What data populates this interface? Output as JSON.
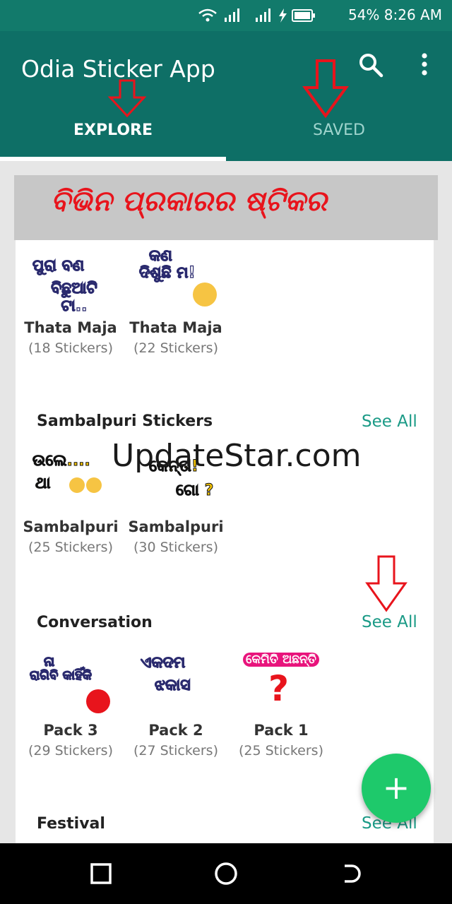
{
  "status_bar": {
    "battery": "54%",
    "time": "8:26 AM"
  },
  "app_bar": {
    "title": "Odia Sticker App",
    "tabs": [
      {
        "label": "EXPLORE",
        "selected": true
      },
      {
        "label": "SAVED",
        "selected": false
      }
    ]
  },
  "banner": {
    "text": "ବିଭିନ ପ୍ରକାରର ଷ୍ଟିକର"
  },
  "watermark": "UpdateStar.com",
  "sections": [
    {
      "title": "",
      "see_all": "",
      "packs": [
        {
          "name": "Thata Maja",
          "count": "(18 Stickers)",
          "sticker_text": [
            "ପୁରା ବଣ",
            "ବିଛୁଆଟି ଟା.."
          ]
        },
        {
          "name": "Thata Maja",
          "count": "(22 Stickers)",
          "sticker_text": [
            "କଣ",
            "ଦିଶୁଛି ମ!"
          ]
        }
      ]
    },
    {
      "title": "Sambalpuri Stickers",
      "see_all": "See All",
      "packs": [
        {
          "name": "Sambalpuri",
          "count": "(25 Stickers)",
          "sticker_text": [
            "ଉଲେ....",
            "ଥା"
          ]
        },
        {
          "name": "Sambalpuri",
          "count": "(30 Stickers)",
          "sticker_text": [
            "କେନ୍ତା!",
            "ଗୋ ?"
          ]
        }
      ]
    },
    {
      "title": "Conversation",
      "see_all": "See All",
      "packs": [
        {
          "name": "Pack 3",
          "count": "(29 Stickers)",
          "sticker_text": [
            "ନା",
            "ରାଗିବି କାହିଁକି"
          ]
        },
        {
          "name": "Pack 2",
          "count": "(27 Stickers)",
          "sticker_text": [
            "ଏକଦମ",
            "ଝକାସ"
          ]
        },
        {
          "name": "Pack 1",
          "count": "(25 Stickers)",
          "sticker_text": [
            "କେମିତି ଅଛନ୍ତି",
            "?"
          ]
        }
      ]
    },
    {
      "title": "Festival",
      "see_all": "See All",
      "packs": []
    }
  ],
  "fab": {
    "label": "+"
  },
  "colors": {
    "appbar": "#0e6f66",
    "status_bar": "#127a6b",
    "accent_link": "#1a9a86",
    "fab": "#1ec96b",
    "annotation_red": "#e8141c"
  }
}
